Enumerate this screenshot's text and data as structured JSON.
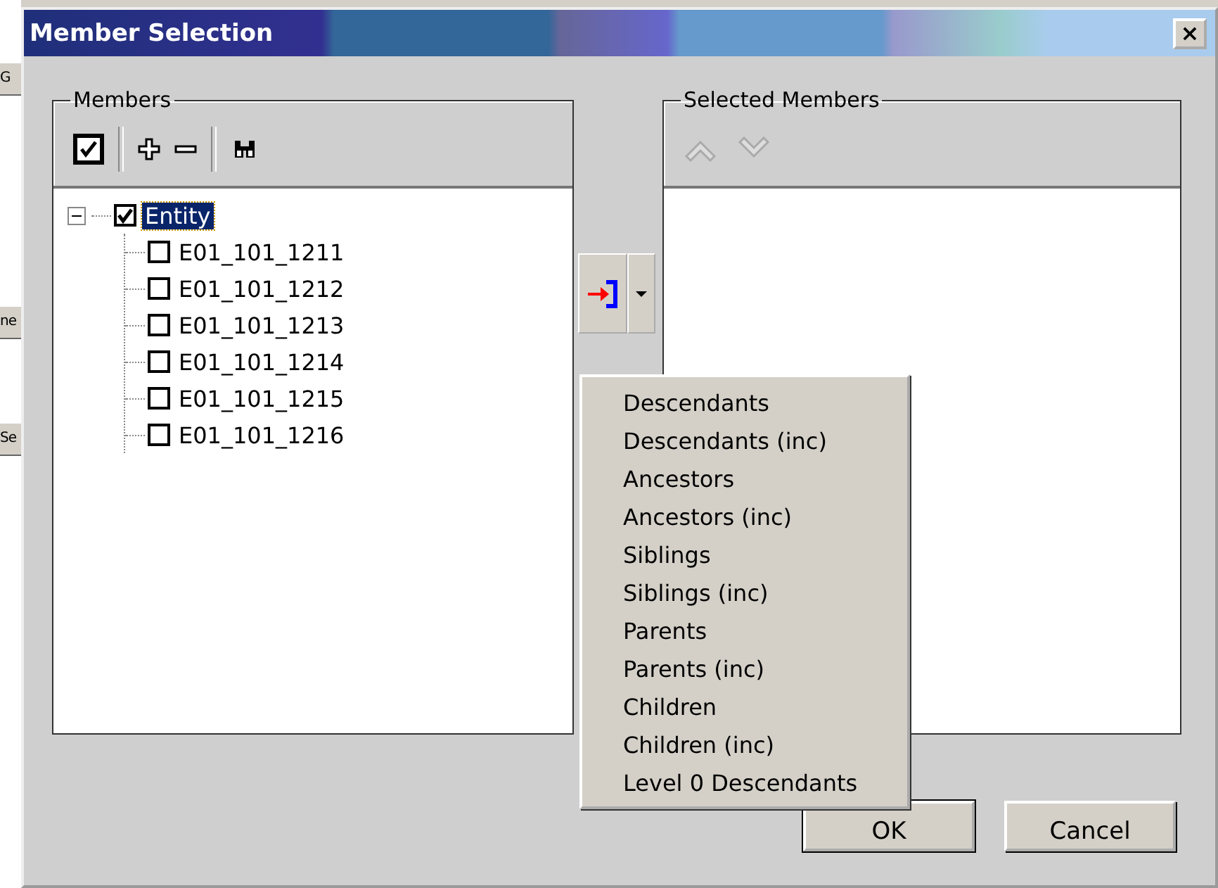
{
  "background_window": {
    "fragments": [
      "G",
      "ne",
      "Se"
    ]
  },
  "window": {
    "title": "Member Selection",
    "close_label": "×"
  },
  "members": {
    "title": "Members",
    "toolbar": [
      {
        "kind": "check"
      },
      {
        "kind": "plus"
      },
      {
        "kind": "minus"
      },
      {
        "kind": "find"
      }
    ],
    "tree": [
      {
        "label": "Entity",
        "checked": true,
        "selected": true,
        "expanded": true,
        "children": [
          {
            "label": "E01_101_1211",
            "checked": false,
            "selected": false
          },
          {
            "label": "E01_101_1212",
            "checked": false,
            "selected": false
          },
          {
            "label": "E01_101_1213",
            "checked": false,
            "selected": false
          },
          {
            "label": "E01_101_1214",
            "checked": false,
            "selected": false
          },
          {
            "label": "E01_101_1215",
            "checked": false,
            "selected": false
          },
          {
            "label": "E01_101_1216",
            "checked": false,
            "selected": false
          }
        ]
      }
    ]
  },
  "selected_members": {
    "title": "Selected Members",
    "toolbar": [
      {
        "kind": "up",
        "disabled": true
      },
      {
        "kind": "down",
        "disabled": true
      }
    ]
  },
  "menu": [
    "Descendants",
    "Descendants (inc)",
    "Ancestors",
    "Ancestors (inc)",
    "Siblings",
    "Siblings (inc)",
    "Parents",
    "Parents (inc)",
    "Children",
    "Children (inc)",
    "Level 0 Descendants"
  ],
  "buttons": [
    "OK",
    "Cancel"
  ]
}
